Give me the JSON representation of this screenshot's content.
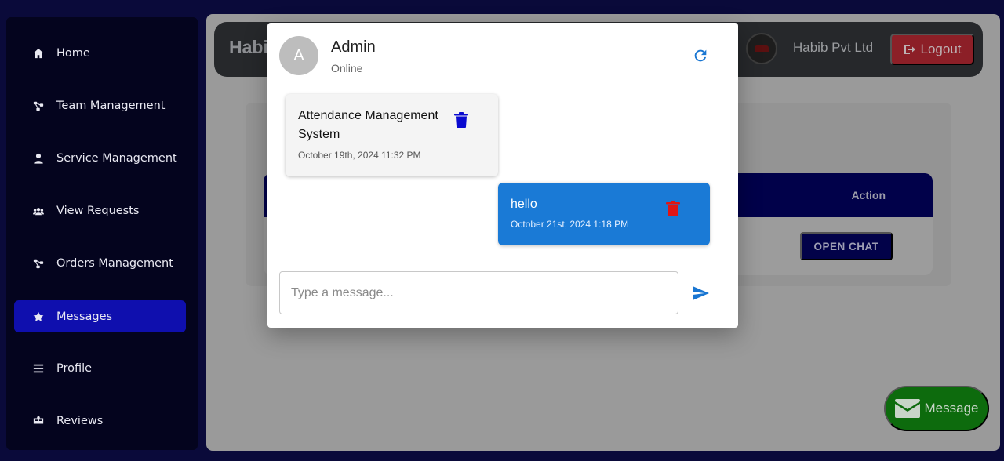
{
  "sidebar": {
    "items": [
      {
        "label": "Home",
        "icon": "home-icon"
      },
      {
        "label": "Team Management",
        "icon": "sitemap-icon"
      },
      {
        "label": "Service Management",
        "icon": "user-icon"
      },
      {
        "label": "View Requests",
        "icon": "users-icon"
      },
      {
        "label": "Orders Management",
        "icon": "sitemap-icon"
      },
      {
        "label": "Messages",
        "icon": "star-icon",
        "active": true
      },
      {
        "label": "Profile",
        "icon": "bars-icon"
      },
      {
        "label": "Reviews",
        "icon": "review-icon"
      }
    ]
  },
  "header": {
    "brand": "Habib",
    "company_name": "Habib Pvt Ltd",
    "logout_label": "Logout"
  },
  "table": {
    "action_header": "Action",
    "open_chat_label": "OPEN CHAT"
  },
  "fab": {
    "label": "Message"
  },
  "chat": {
    "avatar_letter": "A",
    "name": "Admin",
    "status": "Online",
    "messages": [
      {
        "text": "Attendance Management System",
        "time": "October 19th, 2024 11:32 PM",
        "direction": "received"
      },
      {
        "text": "hello",
        "time": "October 21st, 2024 1:18 PM",
        "direction": "sent"
      }
    ],
    "input_placeholder": "Type a message..."
  },
  "colors": {
    "active_nav": "#0f0fae",
    "sent_bubble": "#1a7ad6",
    "accent": "#1976d2",
    "trash_received": "#0a0ad0",
    "trash_sent": "#e01515",
    "fab": "#0d6b0d",
    "logout": "#8c1f27"
  }
}
